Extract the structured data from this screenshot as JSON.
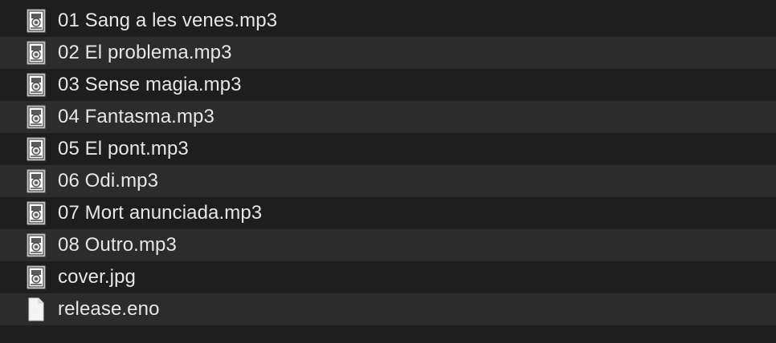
{
  "files": [
    {
      "name": "01 Sang a les venes.mp3",
      "icon": "audio-file-icon"
    },
    {
      "name": "02 El problema.mp3",
      "icon": "audio-file-icon"
    },
    {
      "name": "03 Sense magia.mp3",
      "icon": "audio-file-icon"
    },
    {
      "name": "04 Fantasma.mp3",
      "icon": "audio-file-icon"
    },
    {
      "name": "05 El pont.mp3",
      "icon": "audio-file-icon"
    },
    {
      "name": "06 Odi.mp3",
      "icon": "audio-file-icon"
    },
    {
      "name": "07 Mort anunciada.mp3",
      "icon": "audio-file-icon"
    },
    {
      "name": "08 Outro.mp3",
      "icon": "audio-file-icon"
    },
    {
      "name": "cover.jpg",
      "icon": "image-file-icon"
    },
    {
      "name": "release.eno",
      "icon": "blank-document-icon"
    }
  ],
  "colors": {
    "background": "#1e1e1e",
    "stripe": "#2c2c2c",
    "text": "#e6e6e6"
  }
}
